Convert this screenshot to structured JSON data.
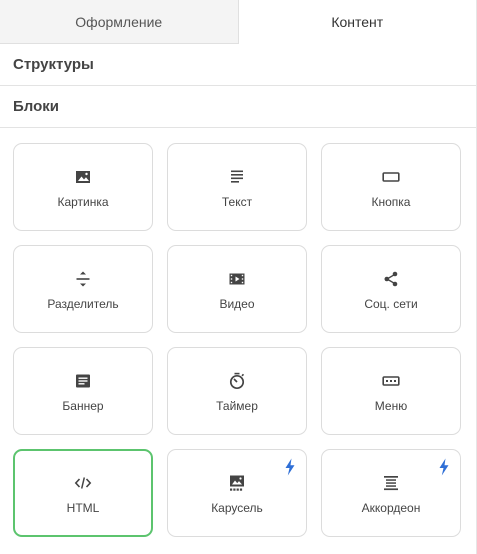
{
  "tabs": [
    {
      "label": "Оформление",
      "active": false
    },
    {
      "label": "Контент",
      "active": true
    }
  ],
  "sections": {
    "structures": "Структуры",
    "blocks": "Блоки"
  },
  "blocks": [
    {
      "label": "Картинка",
      "icon": "image-icon"
    },
    {
      "label": "Текст",
      "icon": "text-icon"
    },
    {
      "label": "Кнопка",
      "icon": "button-icon"
    },
    {
      "label": "Разделитель",
      "icon": "divider-icon"
    },
    {
      "label": "Видео",
      "icon": "video-icon"
    },
    {
      "label": "Соц. сети",
      "icon": "share-icon"
    },
    {
      "label": "Баннер",
      "icon": "banner-icon"
    },
    {
      "label": "Таймер",
      "icon": "timer-icon"
    },
    {
      "label": "Меню",
      "icon": "menu-icon"
    },
    {
      "label": "HTML",
      "icon": "code-icon",
      "selected": true
    },
    {
      "label": "Карусель",
      "icon": "carousel-icon",
      "premium": true
    },
    {
      "label": "Аккордеон",
      "icon": "accordion-icon",
      "premium": true
    }
  ],
  "colors": {
    "selected_border": "#5cc46e",
    "premium_bolt": "#2f6fd6",
    "icon": "#444444"
  }
}
